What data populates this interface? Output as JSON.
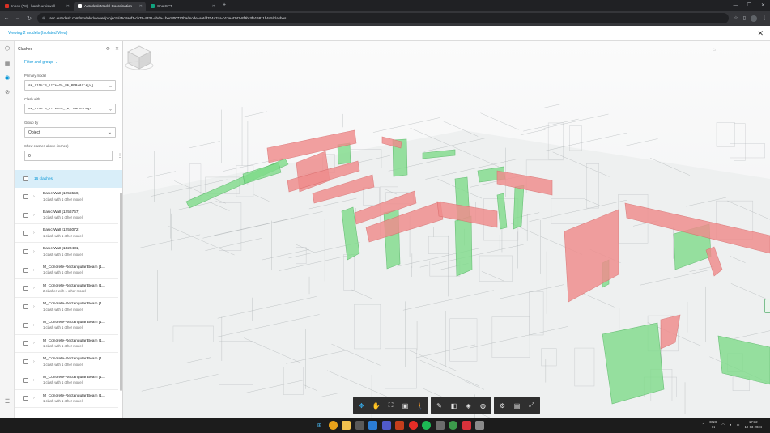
{
  "browser": {
    "tabs": [
      {
        "title": "Inbox (78) - harsh.ursiswell",
        "active": false,
        "color": "#d93025"
      },
      {
        "title": "Autodesk Model Coordination",
        "active": true,
        "color": "#ffffff"
      },
      {
        "title": "ChatGPT",
        "active": false,
        "color": "#10a37f"
      }
    ],
    "new_tab": "+",
    "url": "acc.autodesk.com/modelcr/viewer/projects/a5c4a6f1-cb79-4331-abda-1bec800772ba/model-set/d70447da-b13e-4343-8f9b-3fe16811b4d5/clashes"
  },
  "app": {
    "viewing_label": "Viewing 2 models (Isolated View)",
    "close": "✕"
  },
  "panel": {
    "title": "Clashes",
    "filter_group": "Filter and group",
    "primary_model_label": "Primary model",
    "primary_model_value": "SL_TYPE-B_TYPICAL_ME_BDwJar-1[D]",
    "clash_with_label": "Clash with",
    "clash_with_value": "SL_TYPE-B_TYPICAL_[D]-BaMnhPEQT",
    "group_by_label": "Group by",
    "group_by_value": "Object",
    "show_clashes_label": "Show clashes above (inches)",
    "show_clashes_value": "0",
    "select_all": "16 clashes",
    "items": [
      {
        "name": "Basic Wall [1255556]",
        "sub": "1 clash with 1 other model"
      },
      {
        "name": "Basic Wall [1256767]",
        "sub": "1 clash with 1 other model"
      },
      {
        "name": "Basic Wall [1256072]",
        "sub": "1 clash with 1 other model"
      },
      {
        "name": "Basic Wall [1320431]",
        "sub": "1 clash with 1 other model"
      },
      {
        "name": "M_Concrete-Rectangular Beam [1...",
        "sub": "1 clash with 1 other model"
      },
      {
        "name": "M_Concrete-Rectangular Beam [1...",
        "sub": "2 clashes with 1 other model"
      },
      {
        "name": "M_Concrete-Rectangular Beam [1...",
        "sub": "1 clash with 1 other model"
      },
      {
        "name": "M_Concrete-Rectangular Beam [1...",
        "sub": "1 clash with 1 other model"
      },
      {
        "name": "M_Concrete-Rectangular Beam [1...",
        "sub": "1 clash with 1 other model"
      },
      {
        "name": "M_Concrete-Rectangular Beam [1...",
        "sub": "1 clash with 1 other model"
      },
      {
        "name": "M_Concrete-Rectangular Beam [1...",
        "sub": "1 clash with 1 other model"
      },
      {
        "name": "M_Concrete-Rectangular Beam [1...",
        "sub": "1 clash with 1 other model"
      }
    ]
  },
  "colors": {
    "accent": "#0696d7",
    "clash_red": "#f08c8c",
    "clash_green": "#7fdc8a"
  },
  "taskbar": {
    "lang_top": "ENG",
    "lang_bottom": "IN",
    "time": "17:32",
    "date": "19-03-2024"
  }
}
